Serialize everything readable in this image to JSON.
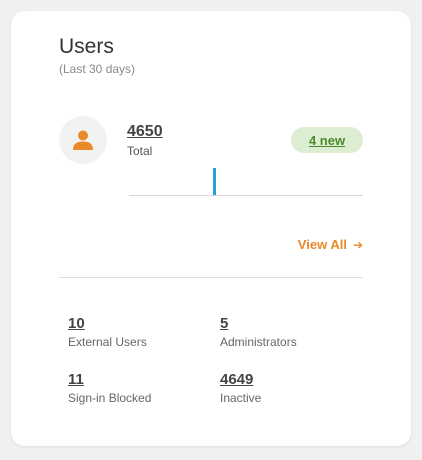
{
  "card": {
    "title": "Users",
    "subtitle": "(Last 30 days)",
    "total_value": "4650",
    "total_label": "Total",
    "new_badge": "4 new",
    "view_all": "View All",
    "view_all_icon": "arrow-right-icon",
    "avatar_icon": "user-icon",
    "colors": {
      "accent_orange": "#e8892a",
      "badge_green_bg": "#dcedd2",
      "badge_green_text": "#4f8a2a",
      "sparkline_blue": "#2a9ed8"
    }
  },
  "stats": [
    {
      "value": "10",
      "label": "External Users"
    },
    {
      "value": "5",
      "label": "Administrators"
    },
    {
      "value": "11",
      "label": "Sign-in Blocked"
    },
    {
      "value": "4649",
      "label": "Inactive"
    }
  ]
}
